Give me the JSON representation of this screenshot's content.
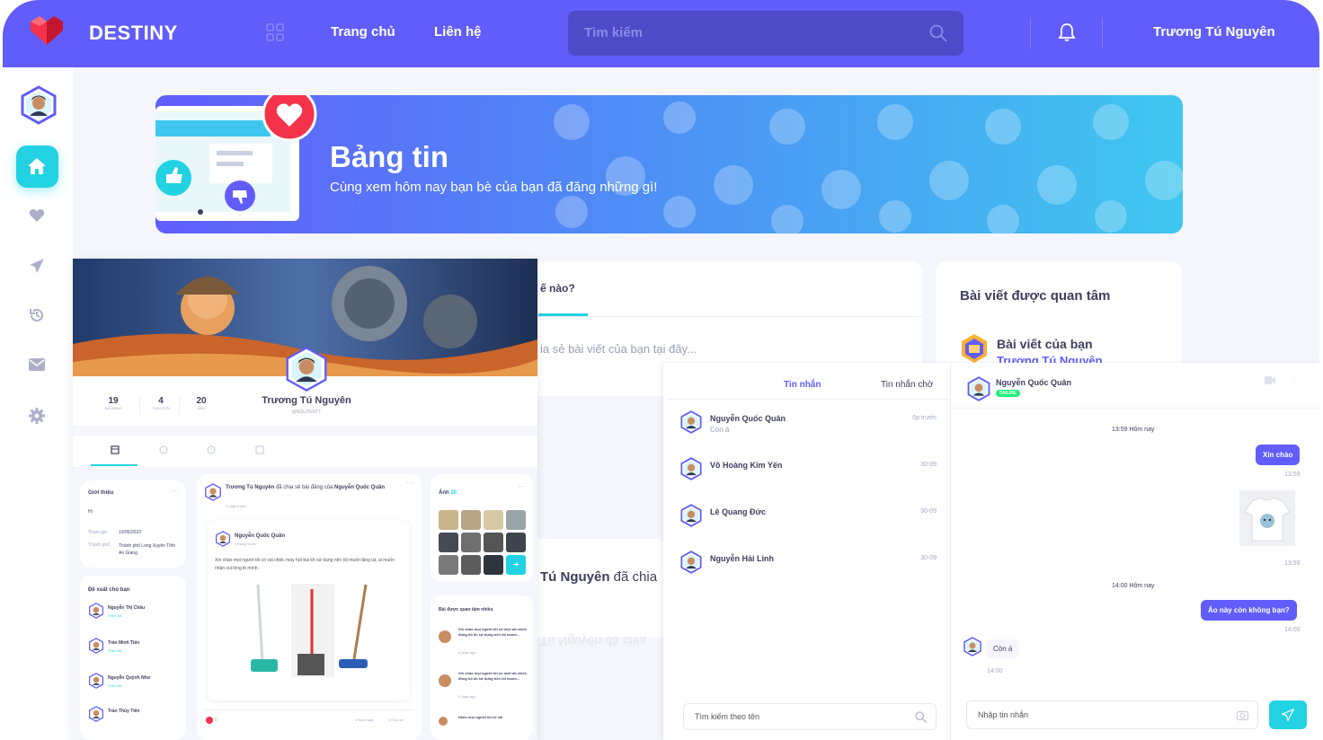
{
  "brand": "DESTINY",
  "nav": {
    "home": "Trang chủ",
    "contact": "Liên hệ"
  },
  "search": {
    "placeholder": "Tìm kiếm"
  },
  "user": {
    "name": "Trương Tú Nguyên"
  },
  "banner": {
    "title": "Bảng tin",
    "subtitle": "Cùng xem hôm nay bạn bè của bạn đã đăng những gì!"
  },
  "profile": {
    "name": "Trương Tú Nguyên",
    "handle": "@NGUYENTT",
    "stats": [
      {
        "value": "19",
        "label": "BÀI ĐĂNG"
      },
      {
        "value": "4",
        "label": "THEO DÕI"
      },
      {
        "value": "20",
        "label": "ẢNH"
      }
    ]
  },
  "about": {
    "title": "Giới thiệu",
    "greeting": "Hi",
    "joined_label": "Tham gia",
    "joined": "10/05/2023",
    "city_label": "Thành phố",
    "city": "Thành phố Long Xuyên Tỉnh An Giang"
  },
  "suggest": {
    "title": "Đề xuất cho bạn",
    "follow": "Theo dõi",
    "people": [
      "Nguyễn Thị Châu",
      "Trần Minh Tiến",
      "Nguyễn Quỳnh Như",
      "Trần Thùy Tiên"
    ]
  },
  "post": {
    "author": "Trương Tú Nguyên",
    "action": "đã chia sẻ bài đăng của",
    "target": "Nguyễn Quốc Quân",
    "time": "3 ngày trước",
    "inner_author": "Nguyễn Quốc Quân",
    "inner_time": "3 tháng trước",
    "text": "Xin chào mọi người tôi có vài chiếc máy hút bụi kh sử dụng nên tôi muốn tặng lại, ai muốn nhận vui lòng ib mình.",
    "likes": "0",
    "comments": "3 Bình luận",
    "shares": "0 Chia sẻ"
  },
  "composer": {
    "question": "ế nào?",
    "placeholder": "ia sẻ bài viết của bạn tại đây...",
    "snippet_name": "Tú Nguyên",
    "snippet_rest": "đã chia",
    "mirror": "Tú Nguyên đã chia"
  },
  "photos": {
    "title": "Ảnh",
    "count": "20"
  },
  "popular": {
    "title": "Bài được quan tâm nhiều",
    "items": [
      {
        "text": "Xin chào mọi người tôi có một vài chiếc đồng hồ kh sử dụng nên tôi muốn...",
        "time": "6 days ago"
      },
      {
        "text": "Xin chào mọi người tôi có một vài chiếc đồng hồ kh sử dụng nên tôi muốn...",
        "time": "6 days ago"
      },
      {
        "text": "Hello mọi người tôi có vài",
        "time": ""
      }
    ]
  },
  "interest": {
    "title": "Bài viết được quan tâm",
    "item_title": "Bài viết của bạn",
    "item_sub": "Trương Tú Nguyên"
  },
  "chat": {
    "tabs": [
      "Tin nhắn",
      "Tin nhắn chờ"
    ],
    "contacts": [
      {
        "name": "Nguyễn Quốc Quân",
        "preview": "Còn á",
        "time": "0p trước"
      },
      {
        "name": "Võ Hoàng Kim Yến",
        "preview": "",
        "time": "30-09"
      },
      {
        "name": "Lê Quang Đức",
        "preview": "",
        "time": "30-09"
      },
      {
        "name": "Nguyễn Hải Linh",
        "preview": "",
        "time": "30-09"
      }
    ],
    "search_placeholder": "Tìm kiếm theo tên",
    "active_name": "Nguyễn Quốc Quân",
    "active_status": "ONLINE",
    "day1": "13:59 Hôm nay",
    "m1": "Xin chào",
    "m1_time": "13:59",
    "img_time": "13:59",
    "day2": "14:00 Hôm nay",
    "m2": "Áo này còn không bạn?",
    "m2_time": "14:00",
    "m3": "Còn á",
    "m3_time": "14:00",
    "input_placeholder": "Nhập tin nhắn"
  },
  "colors": {
    "primary": "#615dfa",
    "accent": "#23d2e2"
  }
}
